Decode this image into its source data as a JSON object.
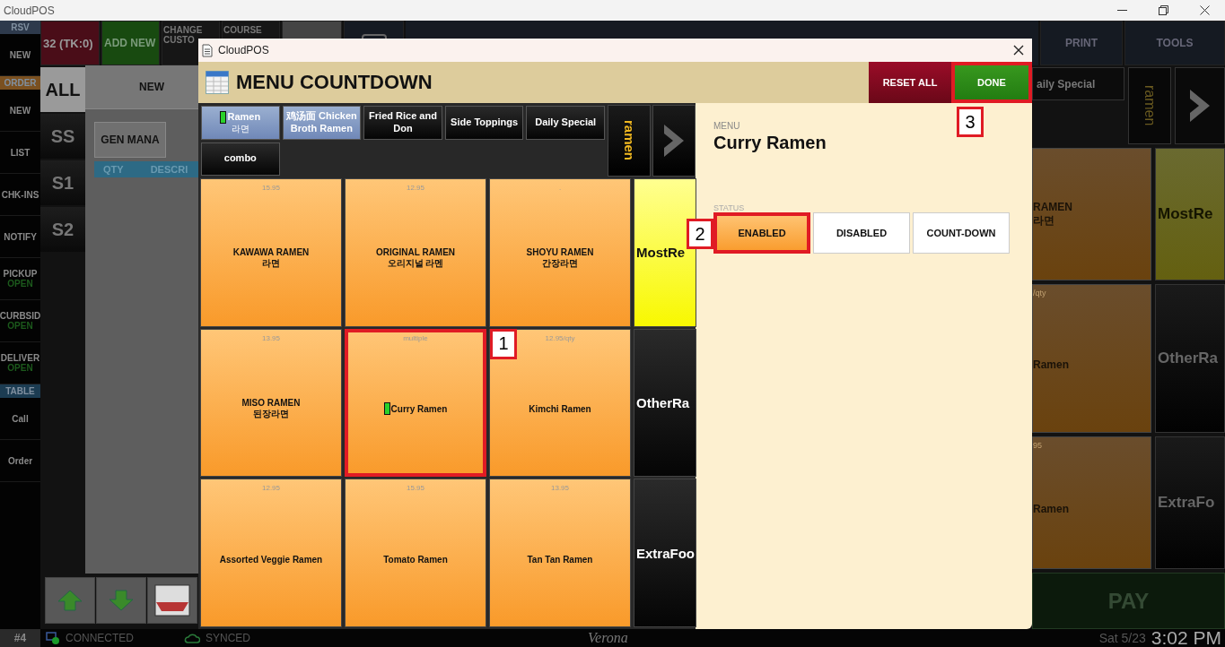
{
  "window": {
    "title": "CloudPOS"
  },
  "sidebar": {
    "items": [
      {
        "label": "RSV",
        "kind": "header",
        "color": "#2e3a4c"
      },
      {
        "label": "NEW",
        "kind": "button"
      },
      {
        "label": "ORDER",
        "kind": "header",
        "color": "#7a5020"
      },
      {
        "label": "NEW",
        "kind": "button"
      },
      {
        "label": "LIST",
        "kind": "button"
      },
      {
        "label": "CHK-INS",
        "kind": "button"
      },
      {
        "label": "NOTIFY",
        "kind": "button"
      },
      {
        "label": "PICKUP",
        "status": "OPEN",
        "kind": "button"
      },
      {
        "label": "CURBSID",
        "status": "OPEN",
        "kind": "button"
      },
      {
        "label": "DELIVER",
        "status": "OPEN",
        "kind": "button"
      },
      {
        "label": "TABLE",
        "kind": "header",
        "color": "#1c3c52"
      },
      {
        "label": "Call",
        "kind": "button"
      },
      {
        "label": "Order",
        "kind": "button"
      }
    ]
  },
  "top_bar": [
    {
      "label": "32 (TK:0)",
      "kind": "ticket"
    },
    {
      "label": "ADD NEW",
      "kind": "add"
    },
    {
      "label": "CHANGE CUSTO",
      "kind": "plain"
    },
    {
      "label": "COURSE",
      "kind": "plain"
    }
  ],
  "top_bar_right": [
    "PRINT",
    "TOOLS"
  ],
  "seats": [
    {
      "label": "ALL",
      "selected": true
    },
    {
      "label": "SS",
      "selected": false
    },
    {
      "label": "S1",
      "selected": false
    },
    {
      "label": "S2",
      "selected": false
    }
  ],
  "order_panel": {
    "header": "NEW",
    "tab": "GEN MANA",
    "columns": [
      "QTY",
      "DESCRI"
    ]
  },
  "background_menu": {
    "category": "aily Special",
    "group_button": "ramen",
    "items": [
      {
        "name": "RAMEN",
        "sub": "라면"
      },
      {
        "price": "/qty",
        "name": "Ramen"
      },
      {
        "price": "95",
        "name": "Ramen"
      }
    ],
    "shortcuts": [
      {
        "label": "MostRe",
        "kind": "highlight"
      },
      {
        "label": "OtherRa",
        "kind": "plain"
      },
      {
        "label": "ExtraFo",
        "kind": "plain"
      }
    ],
    "pay": "PAY"
  },
  "dialog": {
    "title": "CloudPOS",
    "heading": "MENU COUNTDOWN",
    "actions": [
      {
        "label": "RESET ALL",
        "kind": "reset"
      },
      {
        "label": "DONE",
        "kind": "done",
        "callout": "3"
      }
    ],
    "categories": [
      {
        "label": "Ramen",
        "sub": "라면",
        "selected": true,
        "marker": true
      },
      {
        "label": "鸡汤面 Chicken Broth Ramen",
        "selected": true,
        "marker": false
      },
      {
        "label": "Fried Rice and Don",
        "selected": false,
        "marker": false
      },
      {
        "label": "Side Toppings",
        "selected": false,
        "marker": false
      },
      {
        "label": "Daily Special",
        "selected": false,
        "marker": false
      },
      {
        "label": "combo",
        "selected": false,
        "marker": false
      }
    ],
    "group_button": "ramen",
    "items": [
      {
        "price": "15.95",
        "name": "KAWAWA RAMEN",
        "sub": "라면",
        "marker": false
      },
      {
        "price": "12.95",
        "name": "ORIGINAL RAMEN",
        "sub": "오리지널 라멘",
        "marker": false
      },
      {
        "price": ".",
        "name": "SHOYU RAMEN",
        "sub": "간장라면",
        "marker": false
      },
      {
        "price": "13.95",
        "name": "MISO RAMEN",
        "sub": "된장라면",
        "marker": false
      },
      {
        "price": "multiple",
        "name": "Curry Ramen",
        "marker": true,
        "callout": "1"
      },
      {
        "price": "12.95/qty",
        "name": "Kimchi Ramen",
        "marker": false
      },
      {
        "price": "12.95",
        "name": "Assorted Veggie Ramen",
        "marker": false
      },
      {
        "price": "15.95",
        "name": "Tomato Ramen",
        "marker": false
      },
      {
        "price": "13.95",
        "name": "Tan Tan Ramen",
        "marker": false
      }
    ],
    "shortcuts": [
      {
        "label": "MostRe",
        "kind": "highlight"
      },
      {
        "label": "OtherRa",
        "kind": "plain"
      },
      {
        "label": "ExtraFoo",
        "kind": "plain"
      }
    ],
    "detail": {
      "menu_label": "MENU",
      "item_name": "Curry Ramen",
      "status_label": "STATUS",
      "options": [
        {
          "label": "ENABLED",
          "selected": true,
          "callout": "2"
        },
        {
          "label": "DISABLED",
          "selected": false
        },
        {
          "label": "COUNT-DOWN",
          "selected": false
        }
      ]
    }
  },
  "status_bar": {
    "station": "#4",
    "connection": "CONNECTED",
    "sync": "SYNCED",
    "location": "Verona",
    "date": "Sat 5/23",
    "time": "3:02 PM"
  }
}
